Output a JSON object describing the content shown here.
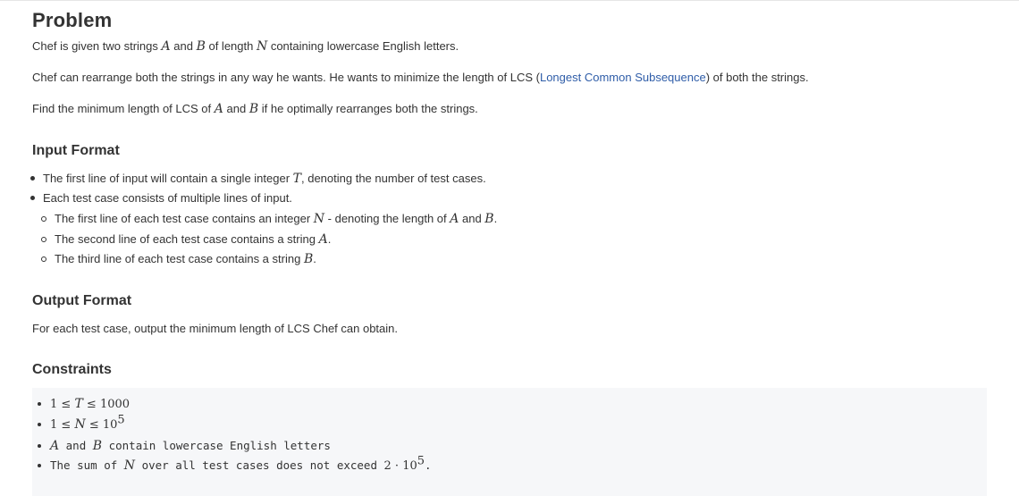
{
  "problem": {
    "heading": "Problem",
    "p1": {
      "pre": "Chef is given two strings ",
      "A": "A",
      "and": " and ",
      "B": "B",
      "mid": " of length ",
      "N": "N",
      "post": " containing lowercase English letters."
    },
    "p2": {
      "pre": "Chef can rearrange both the strings in any way he wants. He wants to minimize the length of LCS (",
      "link": "Longest Common Subsequence",
      "post": ") of both the strings."
    },
    "p3": {
      "pre": "Find the minimum length of LCS of ",
      "A": "A",
      "and": " and ",
      "B": "B",
      "post": " if he optimally rearranges both the strings."
    }
  },
  "input_format": {
    "heading": "Input Format",
    "b1": {
      "pre": "The first line of input will contain a single integer ",
      "T": "T",
      "post": ", denoting the number of test cases."
    },
    "b2": {
      "text": "Each test case consists of multiple lines of input."
    },
    "s1": {
      "pre": "The first line of each test case contains an integer ",
      "N": "N",
      "mid": " - denoting the length of ",
      "A": "A",
      "and": " and ",
      "B": "B",
      "post": "."
    },
    "s2": {
      "pre": "The second line of each test case contains a string ",
      "A": "A",
      "post": "."
    },
    "s3": {
      "pre": "The third line of each test case contains a string ",
      "B": "B",
      "post": "."
    }
  },
  "output_format": {
    "heading": "Output Format",
    "text": "For each test case, output the minimum length of LCS Chef can obtain."
  },
  "constraints": {
    "heading": "Constraints",
    "c1": {
      "lo": "1",
      "le1": " ≤ ",
      "var": "T",
      "le2": " ≤ ",
      "hi": "1000"
    },
    "c2": {
      "lo": "1",
      "le1": " ≤ ",
      "var": "N",
      "le2": " ≤ ",
      "base": "10",
      "exp": "5"
    },
    "c3": {
      "A": "A",
      "and": " and ",
      "B": "B",
      "post": " contain lowercase English letters"
    },
    "c4": {
      "pre": "The sum of ",
      "N": "N",
      "mid": " over all test cases does not exceed ",
      "coef": "2",
      "dot": " · ",
      "base": "10",
      "exp": "5",
      "post": "."
    }
  }
}
